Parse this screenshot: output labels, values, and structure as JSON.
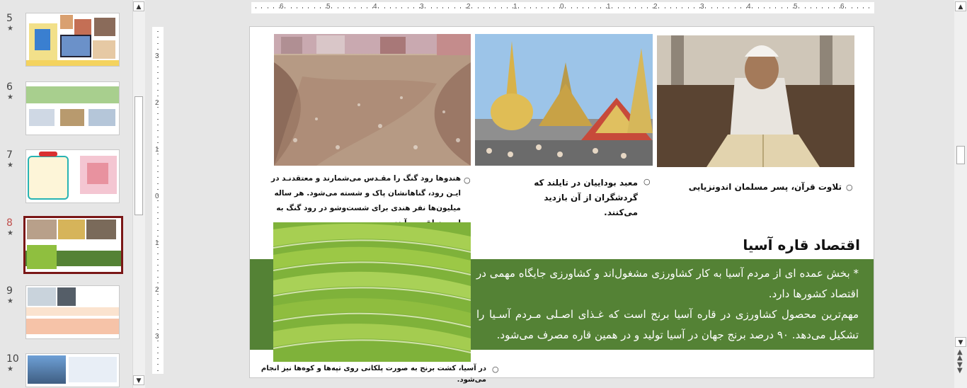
{
  "thumbnails": [
    {
      "num": "5",
      "star": "★",
      "selected": false
    },
    {
      "num": "6",
      "star": "★",
      "selected": false
    },
    {
      "num": "7",
      "star": "★",
      "selected": false
    },
    {
      "num": "8",
      "star": "★",
      "selected": true
    },
    {
      "num": "9",
      "star": "★",
      "selected": false
    },
    {
      "num": "10",
      "star": "★",
      "selected": false
    }
  ],
  "ruler": {
    "h_labels": [
      "6",
      "5",
      "4",
      "3",
      "2",
      "1",
      "0",
      "1",
      "2",
      "3",
      "4",
      "5",
      "6"
    ],
    "v_labels": [
      "3",
      "2",
      "1",
      "0",
      "1",
      "2",
      "3"
    ]
  },
  "slide": {
    "captions": {
      "ganges": "هندوها رود گنگ را مقـدس می‌شمارند و معتقدنـد در ایـن رود، گناهانشان پاک و شسته می‌شود. هر ساله میلیون‌ها نفر هندی برای شست‌وشو در رود گنگ به این منطقه می‌آیند.",
      "thailand": "معبد بوداییان در تایلند که گردشگران از آن بازدید می‌کنند.",
      "quran": "تلاوت قرآن، پسر مسلمان اندونزیایی",
      "rice": "در آسیا، کشت برنج به صورت پلکانی روی تپه‌ها و کوه‌ها نیز انجام می‌شود."
    },
    "bullet_symbol": "○",
    "economy": {
      "title": "اقتصاد قاره آسیا",
      "paragraph1": "* بخش عمده ای از مردم آسیا به کار کشاورزی مشغول‌اند و کشاورزی جایگاه مهمی در اقتصاد کشورها دارد.",
      "paragraph2": "مهم‌ترین محصول کشاورزی در قاره آسیا برنج است که غـذای اصـلی مـردم آسـیا را تشکیل می‌دهد. ۹۰ درصد برنج جهان در آسیا تولید و در همین قاره مصرف می‌شود."
    }
  },
  "colors": {
    "green_band": "#548235",
    "selected_border": "#7a1717",
    "selected_number": "#c0504d"
  }
}
